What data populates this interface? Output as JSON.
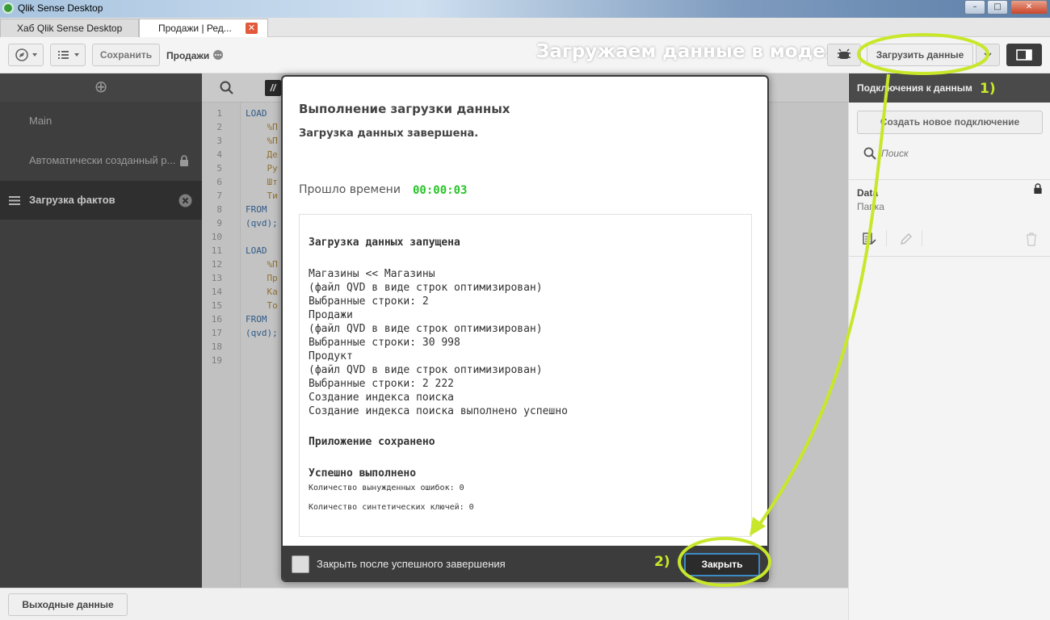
{
  "window": {
    "title": "Qlik Sense Desktop",
    "minimize": "–",
    "maximize": "□",
    "close": "✕"
  },
  "tabs": [
    {
      "label": "Хаб Qlik Sense Desktop"
    },
    {
      "label": "Продажи | Ред...",
      "close": "✕"
    }
  ],
  "toolbar": {
    "save_label": "Сохранить",
    "app_name": "Продажи",
    "load_data_label": "Загрузить данные"
  },
  "annotation": {
    "headline": "Загружаем данные в модель",
    "step1": "1)",
    "step2": "2)",
    "accent": "#c8e72a"
  },
  "sidebar": {
    "add_icon": "⊕",
    "sections": [
      {
        "label": "Main"
      },
      {
        "label": "Автоматически созданный р..."
      },
      {
        "label": "Загрузка фактов"
      }
    ]
  },
  "editor": {
    "line_numbers": [
      "1",
      "2",
      "3",
      "4",
      "5",
      "6",
      "7",
      "8",
      "9",
      "10",
      "11",
      "12",
      "13",
      "14",
      "15",
      "16",
      "17",
      "18",
      "19"
    ],
    "code_lines": [
      "LOAD",
      "    %П",
      "    %П",
      "    Де",
      "    Ру",
      "    Шт",
      "    Ти",
      "FROM",
      "(qvd);",
      "",
      "LOAD",
      "    %П",
      "    Пр",
      "    Ка",
      "    То",
      "FROM",
      "(qvd);",
      "",
      ""
    ]
  },
  "right_panel": {
    "title": "Подключения к данным",
    "create_button": "Создать новое подключение",
    "search_placeholder": "Поиск",
    "connection_name": "Data",
    "connection_type": "Папка"
  },
  "footer": {
    "output_button": "Выходные данные"
  },
  "dialog": {
    "title": "Выполнение загрузки данных",
    "status": "Загрузка данных завершена.",
    "elapsed_label": "Прошло времени",
    "elapsed_value": "00:00:03",
    "log_started": "Загрузка данных запущена",
    "log_lines": [
      "Магазины << Магазины",
      "(файл QVD в виде строк оптимизирован)",
      "Выбранные строки: 2",
      "Продажи",
      "(файл QVD в виде строк оптимизирован)",
      "Выбранные строки: 30 998",
      "Продукт",
      "(файл QVD в виде строк оптимизирован)",
      "Выбранные строки: 2 222",
      "Создание индекса поиска",
      "Создание индекса поиска выполнено успешно"
    ],
    "log_saved": "Приложение сохранено",
    "log_success": "Успешно выполнено",
    "log_forced_errors": "Количество вынужденных ошибок: 0",
    "log_synthetic_keys": "Количество синтетических ключей: 0",
    "close_after_label": "Закрыть после успешного завершения",
    "close_button": "Закрыть",
    "elapsed_color": "#27c427"
  }
}
